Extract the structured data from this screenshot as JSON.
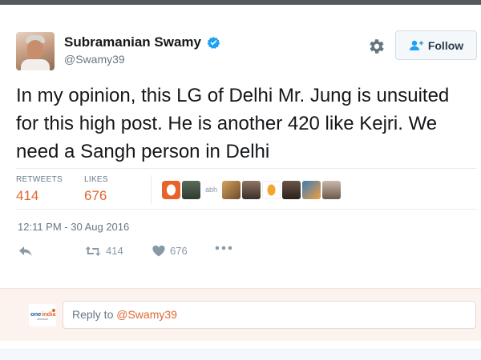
{
  "user": {
    "display_name": "Subramanian Swamy",
    "handle": "@Swamy39",
    "verified_icon": "verified-badge-icon"
  },
  "header": {
    "follow_label": "Follow",
    "settings_icon": "gear-icon",
    "follow_icon": "add-user-icon"
  },
  "tweet": {
    "text": "In my opinion, this LG of Delhi Mr. Jung is unsuited for this high post. He is another 420 like Kejri. We need a Sangh person in Delhi",
    "timestamp": "12:11 PM - 30 Aug 2016"
  },
  "stats": {
    "retweets_label": "RETWEETS",
    "retweets_value": "414",
    "likes_label": "LIKES",
    "likes_value": "676",
    "liker_text": "abh",
    "liker_colors": [
      "#e8632b",
      "#6b7b6a",
      "#ffffff",
      "#c99b5f",
      "#8a6d5b",
      "#e8a53a",
      "#5a4a42",
      "#3a7bb8",
      "#9b8a7a"
    ]
  },
  "actions": {
    "reply_icon": "reply-icon",
    "retweet_icon": "retweet-icon",
    "retweet_count": "414",
    "like_icon": "heart-icon",
    "like_count": "676",
    "more_icon": "more-dots-icon"
  },
  "reply": {
    "prefix": "Reply to ",
    "mention": "@Swamy39",
    "logo_icon": "oneindia-logo"
  },
  "colors": {
    "accent": "#e0662f",
    "verified": "#1da1f2",
    "muted": "#657786"
  }
}
